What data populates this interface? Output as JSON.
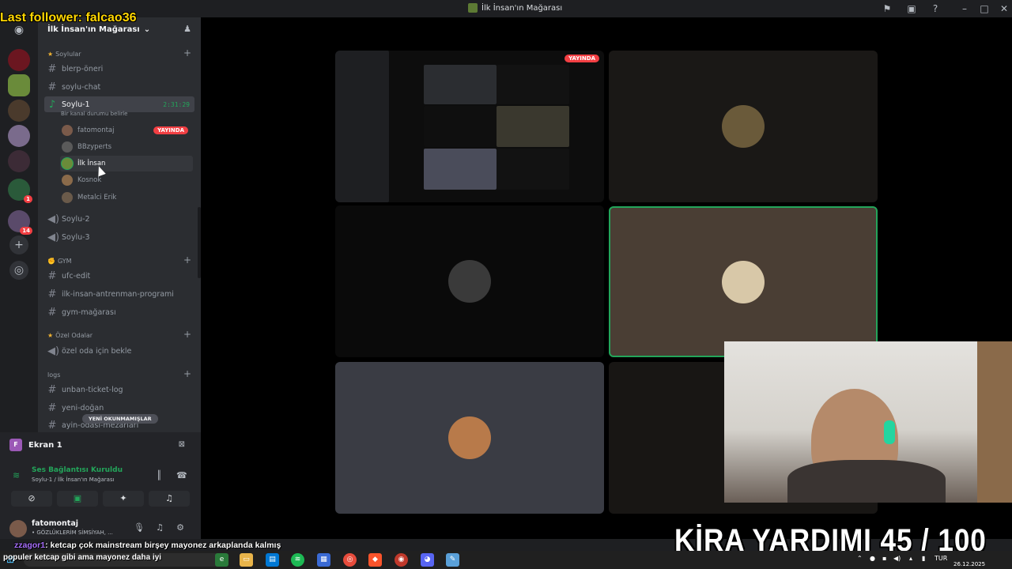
{
  "window": {
    "title": "İlk İnsan'ın Mağarası"
  },
  "overlay": {
    "follower": "Last follower: falcao36",
    "chat_nick": "zzagor1",
    "chat_msg": ": ketcap çok mainstream birşey mayonez arkaplanda kalmış",
    "taskbar_msg": "populer ketcap gibi ama mayonez daha iyi",
    "goal": "KİRA YARDIMI  45 / 100",
    "goal_current": 45,
    "goal_target": 100
  },
  "sidebar": {
    "server_name": "İlk İnsan'ın Mağarası",
    "categories": {
      "soylular": "Soylular",
      "gym": "GYM",
      "ozel": "Özel Odalar",
      "logs": "logs"
    },
    "channels": {
      "blerp": "blerp-öneri",
      "soylu_chat": "soylu-chat",
      "soylu1": "Soylu-1",
      "soylu1_timer": "2:31:29",
      "soylu1_status": "Bir kanal durumu belirle",
      "soylu2": "Soylu-2",
      "soylu3": "Soylu-3",
      "ufc": "ufc-edit",
      "antrenman": "ilk-insan-antrenman-programi",
      "gym_magarasi": "gym-mağarası",
      "ozel_oda": "özel oda için bekle",
      "unban": "unban-ticket-log",
      "yeni_dogan": "yeni-doğan",
      "ayin": "ayin-odası-mezarları"
    },
    "voice_users": [
      "fatomontaj",
      "BBzyperts",
      "İlk İnsan",
      "Kosnok",
      "Metalci Erik"
    ],
    "live_badge": "YAYINDA",
    "new_unreads": "YENİ OKUNMAMIŞLAR"
  },
  "guild_badges": {
    "b1": "1",
    "b2": "14"
  },
  "panel": {
    "ekran": "Ekran 1",
    "voice_status": "Ses Bağlantısı Kuruldu",
    "voice_sub": "Soylu-1 / İlk İnsan'ın Mağarası",
    "user_name": "fatomontaj",
    "user_status": "• GÖZLÜKLERİM SİMSİYAH, ..."
  },
  "stage": {
    "live_badge": "YAYINDA"
  },
  "taskbar": {
    "lang": "TUR",
    "date": "26.12.2025"
  },
  "colors": {
    "accent_green": "#23a55a",
    "live_red": "#f23f43",
    "follower_yellow": "#ffd600"
  }
}
